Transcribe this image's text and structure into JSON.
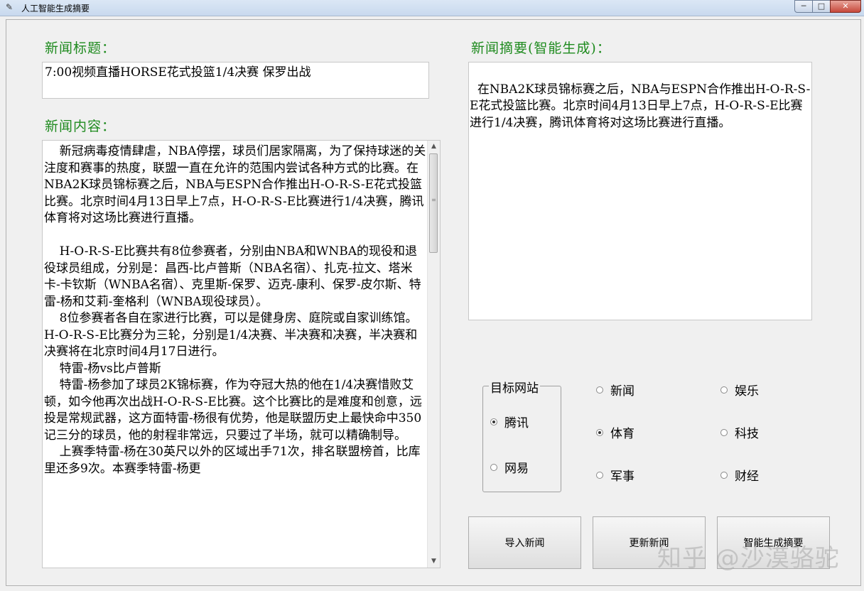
{
  "window": {
    "title": "人工智能生成摘要",
    "minimize": "─",
    "maximize": "□",
    "close": "✕"
  },
  "labels": {
    "news_title": "新闻标题：",
    "news_content": "新闻内容：",
    "news_summary": "新闻摘要(智能生成)："
  },
  "fields": {
    "title_value": "7:00视频直播HORSE花式投篮1/4决赛 保罗出战",
    "content_value": "    新冠病毒疫情肆虐，NBA停摆，球员们居家隔离，为了保持球迷的关注度和赛事的热度，联盟一直在允许的范围内尝试各种方式的比赛。在NBA2K球员锦标赛之后，NBA与ESPN合作推出H-O-R-S-E花式投篮比赛。北京时间4月13日早上7点，H-O-R-S-E比赛进行1/4决赛，腾讯体育将对这场比赛进行直播。\n\n    H-O-R-S-E比赛共有8位参赛者，分别由NBA和WNBA的现役和退役球员组成，分别是：昌西-比卢普斯（NBA名宿）、扎克-拉文、塔米卡-卡钦斯（WNBA名宿）、克里斯-保罗、迈克-康利、保罗-皮尔斯、特雷-杨和艾莉-奎格利（WNBA现役球员）。\n    8位参赛者各自在家进行比赛，可以是健身房、庭院或自家训练馆。H-O-R-S-E比赛分为三轮，分别是1/4决赛、半决赛和决赛，半决赛和决赛将在北京时间4月17日进行。\n    特雷-杨vs比卢普斯\n    特雷-杨参加了球员2K锦标赛，作为夺冠大热的他在1/4决赛惜败艾顿，如今他再次出战H-O-R-S-E比赛。这个比赛比的是难度和创意，远投是常规武器，这方面特雷-杨很有优势，他是联盟历史上最快命中350记三分的球员，他的射程非常远，只要过了半场，就可以精确制导。\n    上赛季特雷-杨在30英尺以外的区域出手71次，排名联盟榜首，比库里还多9次。本赛季特雷-杨更",
    "summary_value": "在NBA2K球员锦标赛之后，NBA与ESPN合作推出H-O-R-S-E花式投篮比赛。北京时间4月13日早上7点，H-O-R-S-E比赛进行1/4决赛，腾讯体育将对这场比赛进行直播。"
  },
  "target_site": {
    "legend": "目标网站",
    "options": [
      {
        "label": "腾讯",
        "selected": true
      },
      {
        "label": "网易",
        "selected": false
      }
    ]
  },
  "categories": [
    {
      "label": "新闻",
      "selected": false
    },
    {
      "label": "娱乐",
      "selected": false
    },
    {
      "label": "体育",
      "selected": true
    },
    {
      "label": "科技",
      "selected": false
    },
    {
      "label": "军事",
      "selected": false
    },
    {
      "label": "财经",
      "selected": false
    }
  ],
  "buttons": {
    "import": "导入新闻",
    "update": "更新新闻",
    "generate": "智能生成摘要"
  },
  "watermark": "知乎 @沙漠骆驼"
}
